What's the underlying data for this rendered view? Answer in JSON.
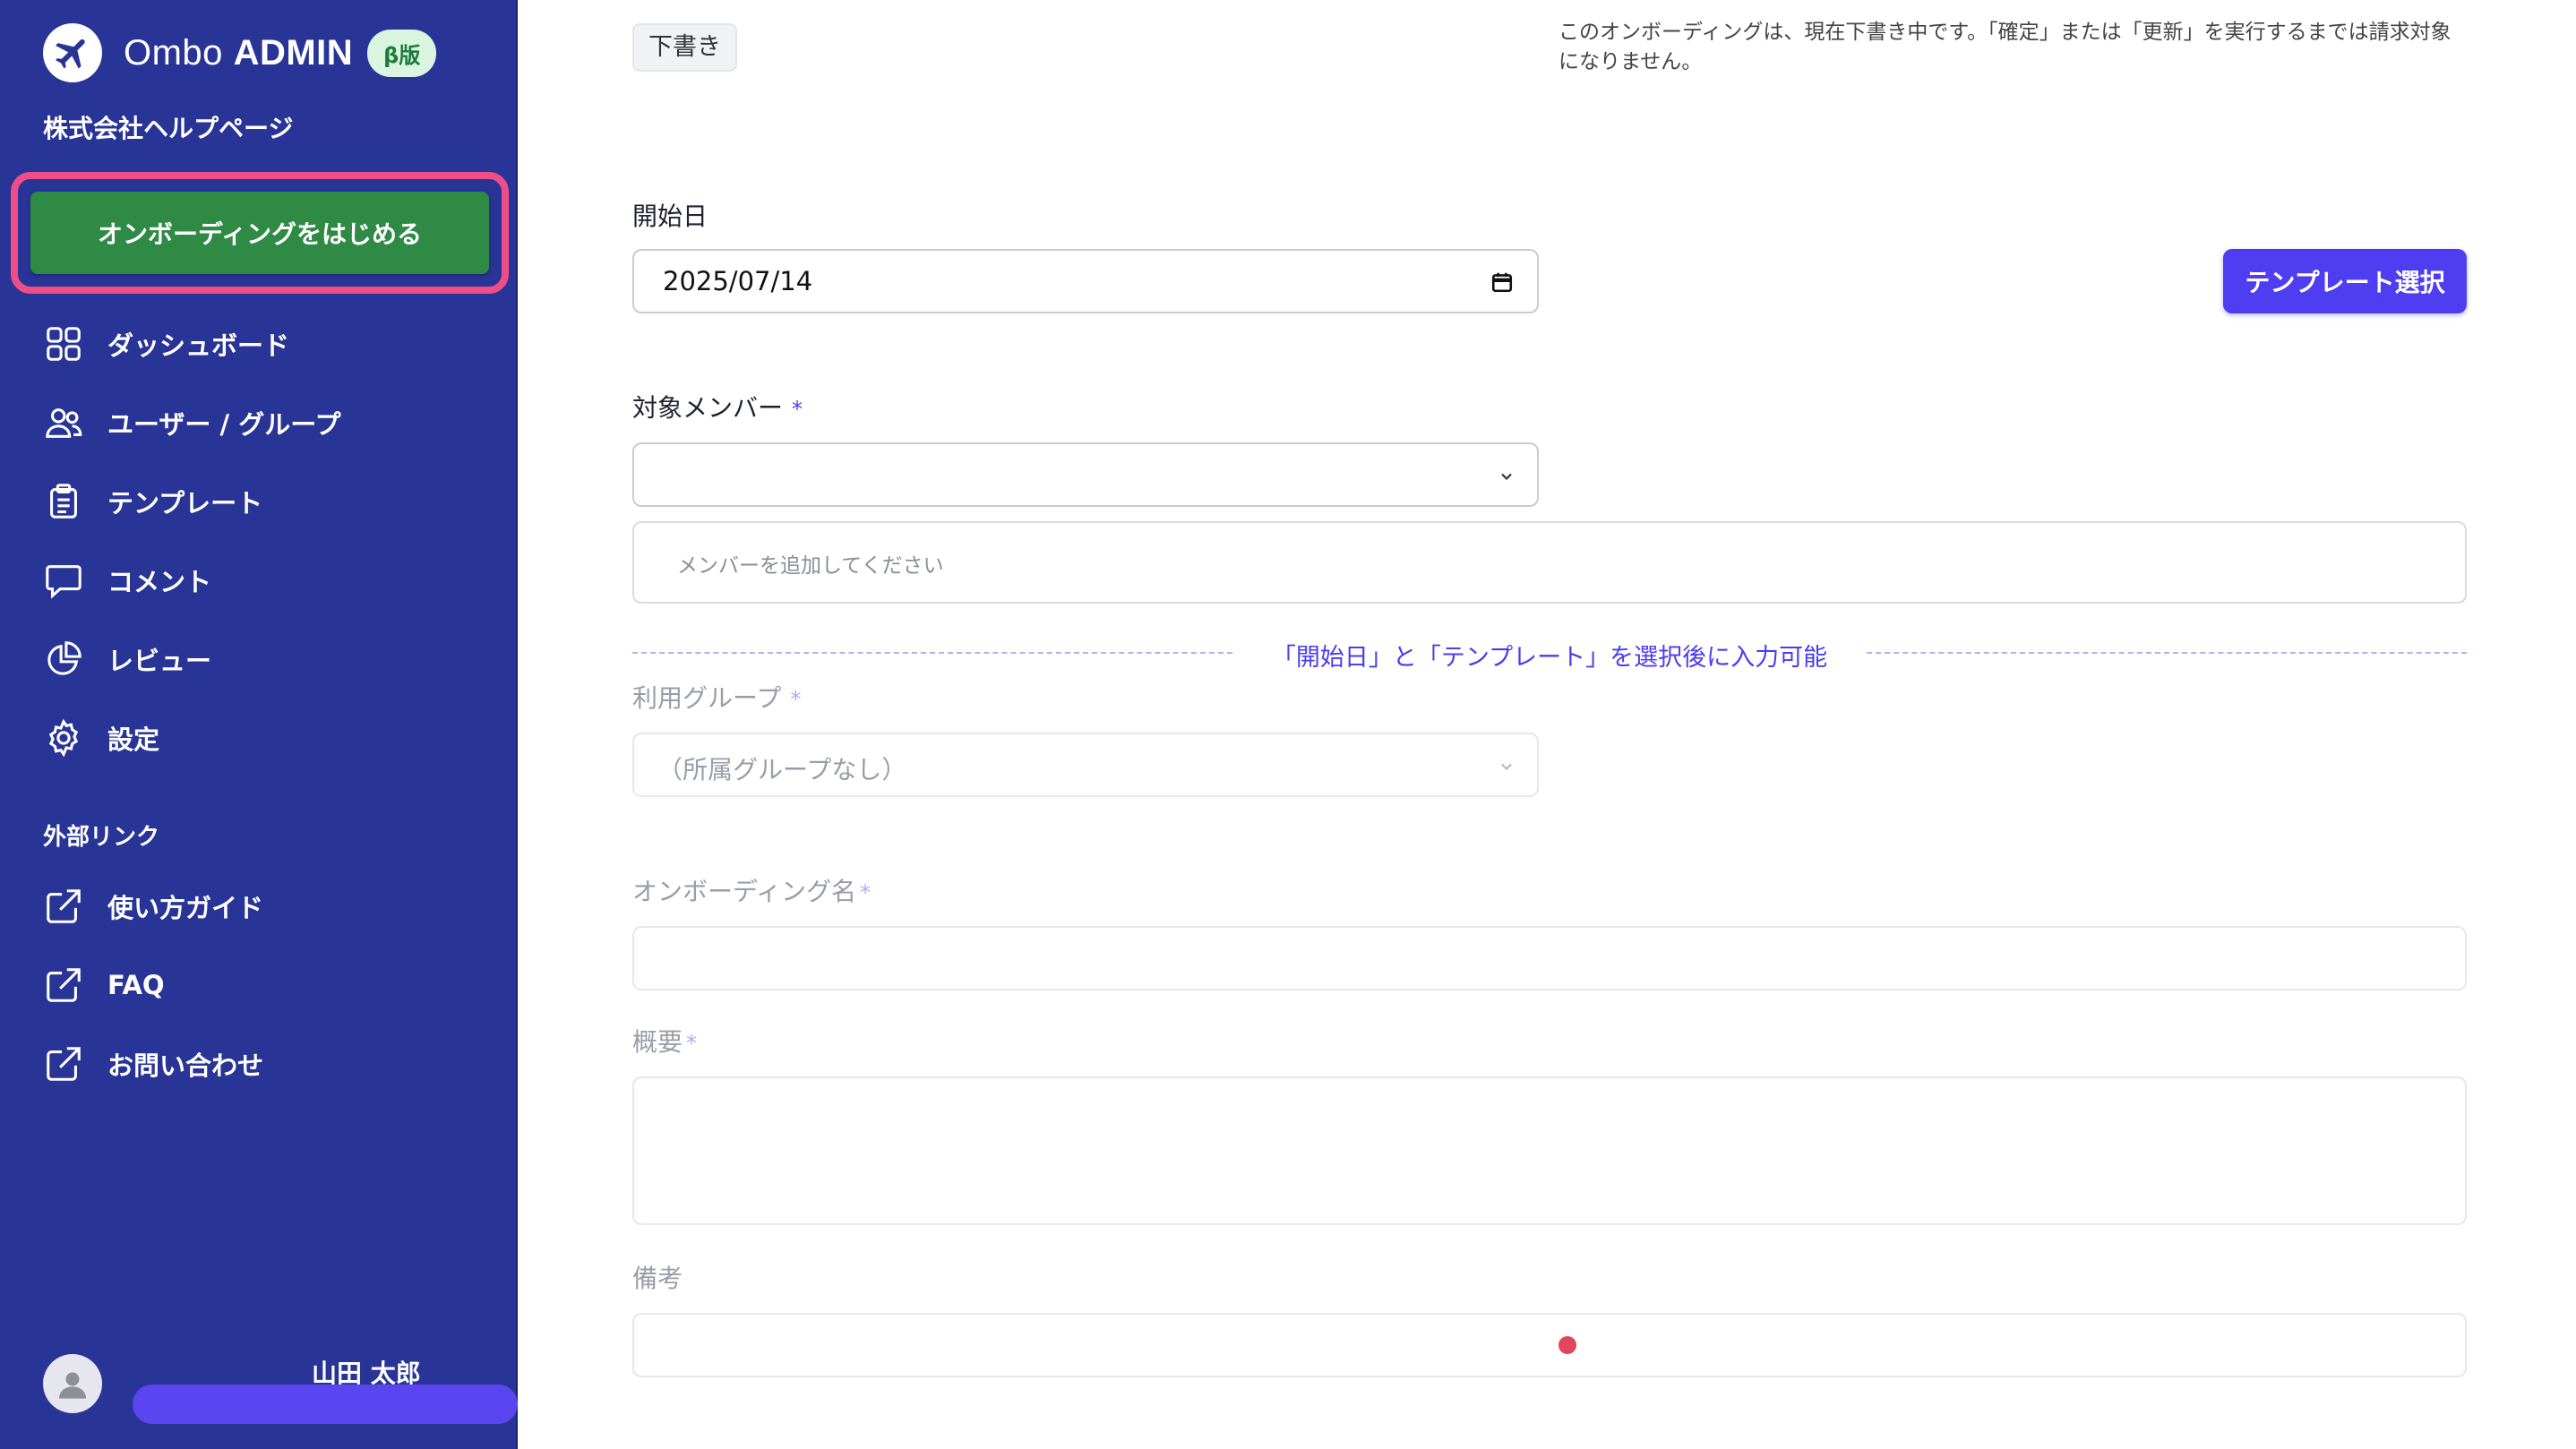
{
  "brand": {
    "name_light": "Ombo",
    "name_bold": "ADMIN",
    "badge": "β版"
  },
  "company": "株式会社ヘルプページ",
  "start_button": "オンボーディングをはじめる",
  "nav": [
    {
      "label": "ダッシュボード",
      "icon": "dashboard-icon"
    },
    {
      "label": "ユーザー / グループ",
      "icon": "users-icon"
    },
    {
      "label": "テンプレート",
      "icon": "clipboard-icon"
    },
    {
      "label": "コメント",
      "icon": "comment-icon"
    },
    {
      "label": "レビュー",
      "icon": "pie-chart-icon"
    },
    {
      "label": "設定",
      "icon": "gear-icon"
    }
  ],
  "external": {
    "title": "外部リンク",
    "items": [
      {
        "label": "使い方ガイド",
        "icon": "external-link-icon"
      },
      {
        "label": "FAQ",
        "icon": "external-link-icon"
      },
      {
        "label": "お問い合わせ",
        "icon": "external-link-icon"
      }
    ]
  },
  "user": {
    "name": "山田 太郎"
  },
  "form": {
    "status_badge": "下書き",
    "status_note": "このオンボーディングは、現在下書き中です。「確定」または「更新」を実行するまでは請求対象になりません。",
    "start_date": {
      "label": "開始日",
      "value": "2025/07/14"
    },
    "template_button": "テンプレート選択",
    "members": {
      "label": "対象メンバー",
      "required": "*",
      "placeholder": "メンバーを追加してください"
    },
    "lock_notice": "「開始日」と「テンプレート」を選択後に入力可能",
    "group": {
      "label": "利用グループ",
      "required": "*",
      "value": "（所属グループなし）"
    },
    "onboarding_name": {
      "label": "オンボーディング名",
      "required": "*"
    },
    "summary": {
      "label": "概要",
      "required": "*"
    },
    "notes": {
      "label": "備考"
    }
  },
  "colors": {
    "sidebar": "#283596",
    "accent": "#4f3df2",
    "start_button": "#2f8a45",
    "highlight": "#ee4e87"
  }
}
